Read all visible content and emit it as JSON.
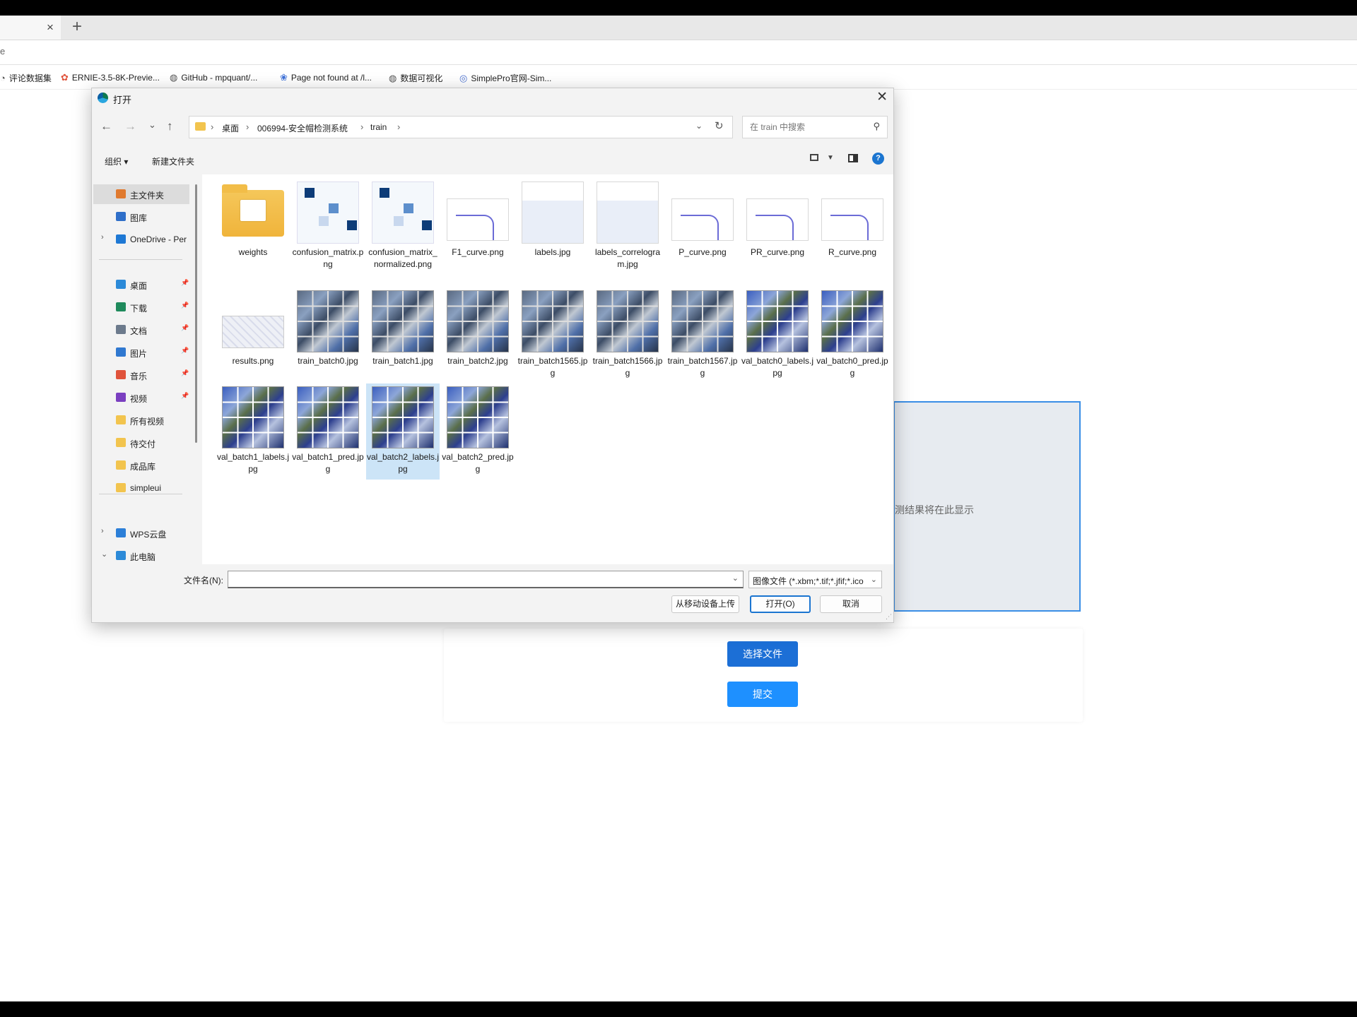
{
  "browser": {
    "tab_close": "×",
    "tab_new": "+",
    "address_text": "e",
    "bookmarks": [
      {
        "icon": "globe-icon",
        "label": "评论数据集"
      },
      {
        "icon": "ernie-icon",
        "label": "ERNIE-3.5-8K-Previe..."
      },
      {
        "icon": "globe-icon",
        "label": "GitHub - mpquant/..."
      },
      {
        "icon": "paw-icon",
        "label": "Page not found at /l..."
      },
      {
        "icon": "globe-icon",
        "label": "数据可视化"
      },
      {
        "icon": "simplepro-icon",
        "label": "SimplePro官网-Sim..."
      }
    ]
  },
  "page": {
    "result_placeholder": "测结果将在此显示",
    "choose_file_label": "选择文件",
    "submit_label": "提交"
  },
  "dialog": {
    "title": "打开",
    "close": "✕",
    "nav": {
      "back": "←",
      "forward": "→",
      "recent": "⌄",
      "up": "↑"
    },
    "breadcrumb": [
      "桌面",
      "006994-安全帽检测系统",
      "train"
    ],
    "breadcrumb_sep": "›",
    "search_placeholder": "在 train 中搜索",
    "toolbar": {
      "organize": "组织 ▾",
      "new_folder": "新建文件夹",
      "help": "?"
    },
    "sidebar": [
      {
        "label": "主文件夹",
        "icon": "home-icon",
        "color": "#e07a2f",
        "selected": true,
        "chev": "",
        "pin": false
      },
      {
        "label": "图库",
        "icon": "gallery-icon",
        "color": "#2f6fc9",
        "selected": false,
        "chev": "",
        "pin": false
      },
      {
        "label": "OneDrive - Per",
        "icon": "cloud-icon",
        "color": "#1e78d4",
        "selected": false,
        "chev": "›",
        "pin": false
      },
      {
        "label": "桌面",
        "icon": "desktop-icon",
        "color": "#2c8ad8",
        "selected": false,
        "chev": "",
        "pin": true
      },
      {
        "label": "下载",
        "icon": "download-icon",
        "color": "#1f8a5c",
        "selected": false,
        "chev": "",
        "pin": true
      },
      {
        "label": "文档",
        "icon": "document-icon",
        "color": "#6c7a8c",
        "selected": false,
        "chev": "",
        "pin": true
      },
      {
        "label": "图片",
        "icon": "picture-icon",
        "color": "#2f78d0",
        "selected": false,
        "chev": "",
        "pin": true
      },
      {
        "label": "音乐",
        "icon": "music-icon",
        "color": "#e0533b",
        "selected": false,
        "chev": "",
        "pin": true
      },
      {
        "label": "视频",
        "icon": "video-icon",
        "color": "#7a3fc0",
        "selected": false,
        "chev": "",
        "pin": true
      },
      {
        "label": "所有视频",
        "icon": "folder-icon",
        "color": "#f2c44e",
        "selected": false,
        "chev": "",
        "pin": false
      },
      {
        "label": "待交付",
        "icon": "folder-icon",
        "color": "#f2c44e",
        "selected": false,
        "chev": "",
        "pin": false
      },
      {
        "label": "成品库",
        "icon": "folder-icon",
        "color": "#f2c44e",
        "selected": false,
        "chev": "",
        "pin": false
      },
      {
        "label": "simpleui",
        "icon": "folder-icon",
        "color": "#f2c44e",
        "selected": false,
        "chev": "",
        "pin": false
      },
      {
        "label": "WPS云盘",
        "icon": "cloud-icon",
        "color": "#2c7fd8",
        "selected": false,
        "chev": "›",
        "pin": false
      },
      {
        "label": "此电脑",
        "icon": "computer-icon",
        "color": "#2c8ad8",
        "selected": false,
        "chev": "⌄",
        "pin": false
      }
    ],
    "files": [
      {
        "name": "weights",
        "kind": "folder"
      },
      {
        "name": "confusion_matrix.png",
        "kind": "conf"
      },
      {
        "name": "confusion_matrix_normalized.png",
        "kind": "conf"
      },
      {
        "name": "F1_curve.png",
        "kind": "curve"
      },
      {
        "name": "labels.jpg",
        "kind": "labels"
      },
      {
        "name": "labels_correlogram.jpg",
        "kind": "labels"
      },
      {
        "name": "P_curve.png",
        "kind": "curve"
      },
      {
        "name": "PR_curve.png",
        "kind": "curve"
      },
      {
        "name": "R_curve.png",
        "kind": "curve"
      },
      {
        "name": "results.png",
        "kind": "results"
      },
      {
        "name": "train_batch0.jpg",
        "kind": "mosaic"
      },
      {
        "name": "train_batch1.jpg",
        "kind": "mosaic"
      },
      {
        "name": "train_batch2.jpg",
        "kind": "mosaic"
      },
      {
        "name": "train_batch1565.jpg",
        "kind": "mosaic"
      },
      {
        "name": "train_batch1566.jpg",
        "kind": "mosaic"
      },
      {
        "name": "train_batch1567.jpg",
        "kind": "mosaic"
      },
      {
        "name": "val_batch0_labels.jpg",
        "kind": "val"
      },
      {
        "name": "val_batch0_pred.jpg",
        "kind": "val"
      },
      {
        "name": "val_batch1_labels.jpg",
        "kind": "val"
      },
      {
        "name": "val_batch1_pred.jpg",
        "kind": "val"
      },
      {
        "name": "val_batch2_labels.jpg",
        "kind": "val",
        "selected": true
      },
      {
        "name": "val_batch2_pred.jpg",
        "kind": "val"
      }
    ],
    "filename_label": "文件名(N):",
    "filename_value": "",
    "filetype": "图像文件 (*.xbm;*.tif;*.jfif;*.ico",
    "upload_mobile_label": "从移动设备上传",
    "open_label": "打开(O)",
    "cancel_label": "取消"
  }
}
